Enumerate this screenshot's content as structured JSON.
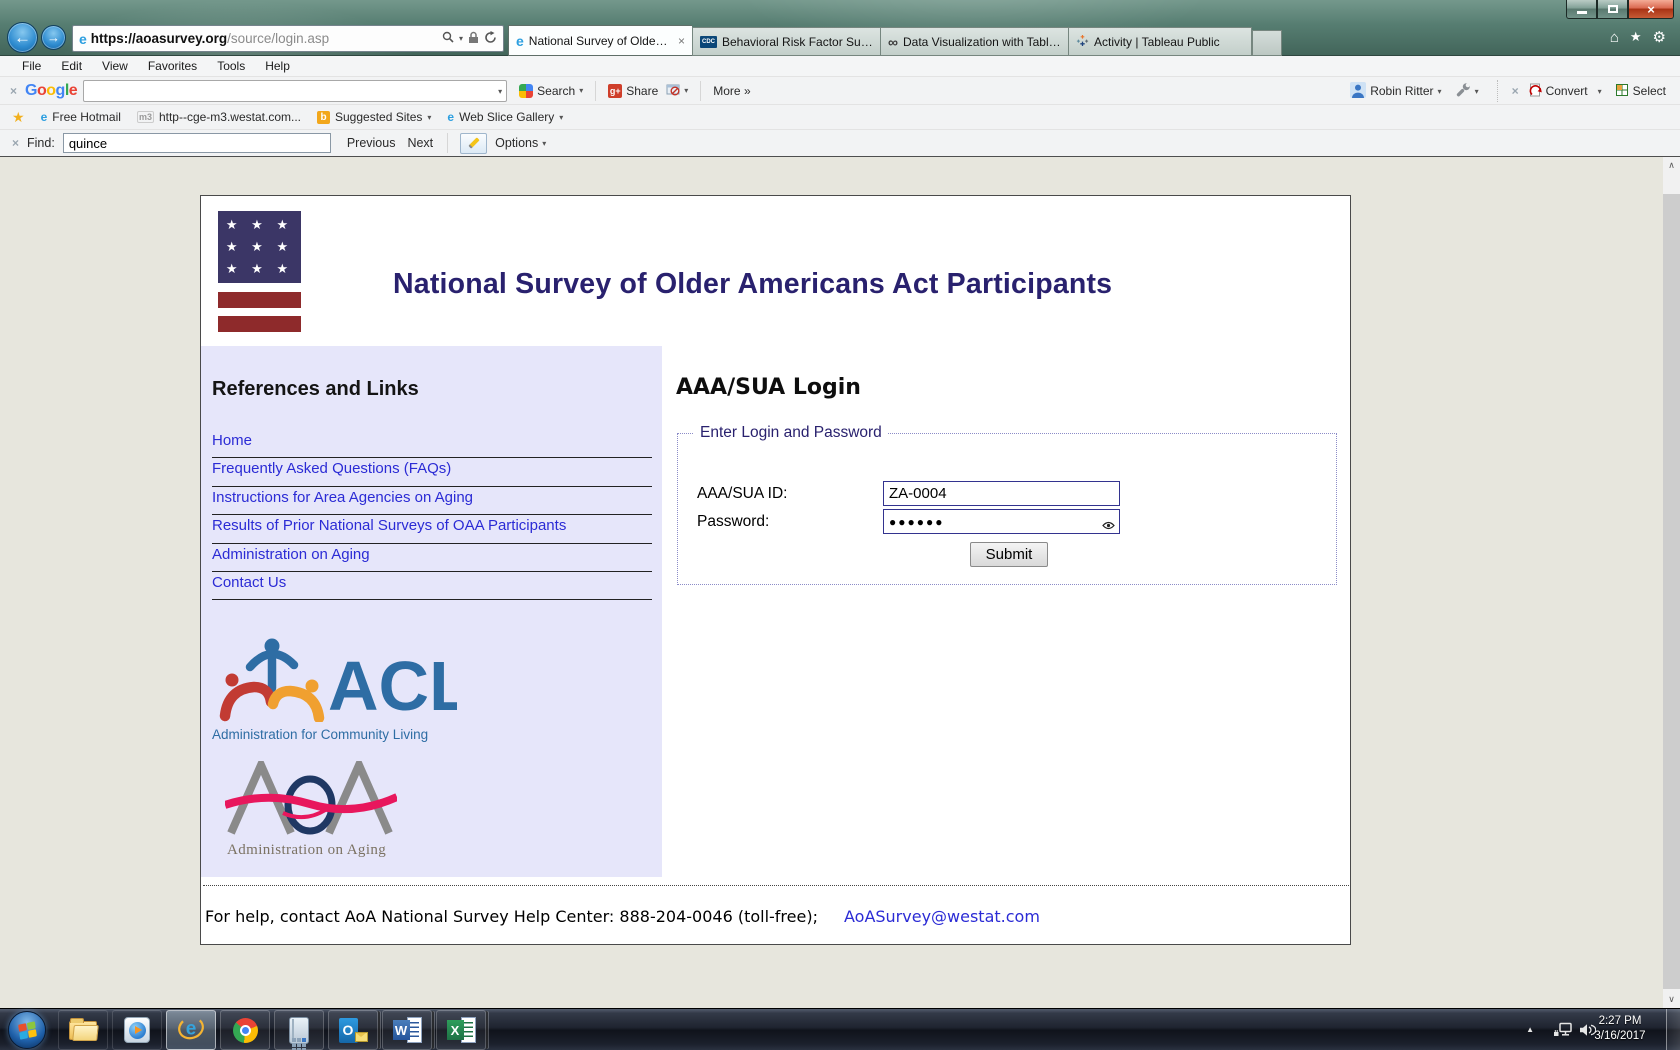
{
  "glyphs": {
    "close": "×",
    "dropdown": "▾",
    "back_arrow": "←",
    "forward_arrow": "→",
    "home": "⌂",
    "star": "★",
    "gear": "⚙",
    "infinity": "∞",
    "e": "e",
    "cdc": "CDC",
    "gplus": "g+",
    "b": "b",
    "m3": "m3",
    "star_row": "★ ★ ★",
    "up_chevron": "∧",
    "down_chevron": "∨",
    "tray_up": "▲",
    "letter_o": "O",
    "letter_w": "W",
    "letter_x": "X"
  },
  "browser": {
    "address": {
      "host": "https://aoasurvey.org",
      "path": "/source/login.asp"
    },
    "tabs": [
      {
        "label": "National Survey of Older A...",
        "icon": "internet-explorer"
      },
      {
        "label": "Behavioral Risk Factor Surveilla...",
        "icon": "cdc"
      },
      {
        "label": "Data Visualization with Tablea...",
        "icon": "tableau-infinity"
      },
      {
        "label": "Activity | Tableau Public",
        "icon": "tableau-public"
      }
    ],
    "menu_items": [
      "File",
      "Edit",
      "View",
      "Favorites",
      "Tools",
      "Help"
    ],
    "google": {
      "letters": [
        "G",
        "o",
        "o",
        "g",
        "l",
        "e"
      ],
      "search_label": "Search",
      "share_label": "Share",
      "more_label": "More »",
      "user_name": "Robin Ritter",
      "convert_label": "Convert",
      "select_label": "Select"
    },
    "favorites": {
      "items": [
        "Free Hotmail",
        "http--cge-m3.westat.com...",
        "Suggested Sites",
        "Web Slice Gallery"
      ]
    },
    "find": {
      "label": "Find:",
      "value": "quince",
      "previous_label": "Previous",
      "next_label": "Next",
      "options_label": "Options"
    }
  },
  "page": {
    "title": "National Survey of Older Americans Act Participants",
    "sidebar": {
      "heading": "References and Links",
      "links": [
        "Home",
        "Frequently Asked Questions (FAQs)",
        "Instructions for Area Agencies on Aging",
        "Results of Prior National Surveys of OAA Participants",
        "Administration on Aging",
        "Contact Us"
      ],
      "acl_text": "ACL",
      "acl_subtitle": "Administration for Community Living",
      "aoa_subtitle": "Administration on Aging"
    },
    "login": {
      "heading": "AAA/SUA Login",
      "legend": "Enter Login and Password",
      "id_label": "AAA/SUA ID:",
      "id_value": "ZA-0004",
      "password_label": "Password:",
      "password_value": "●●●●●●",
      "submit_label": "Submit"
    },
    "footer": {
      "text": "For help, contact AoA National Survey Help Center: 888-204-0046 (toll-free);",
      "email": "AoASurvey@westat.com"
    }
  },
  "taskbar": {
    "apps": [
      "start",
      "windows-explorer",
      "windows-media-player",
      "internet-explorer",
      "google-chrome",
      "calculator",
      "outlook",
      "word",
      "excel"
    ],
    "clock": {
      "time": "2:27 PM",
      "date": "3/16/2017"
    }
  },
  "colors": {
    "link_blue": "#2B2BD5",
    "title_navy": "#29216E",
    "sidebar_lavender": "#E6E6FA",
    "flag_navy": "#3B3666",
    "flag_red": "#8E2A2B",
    "acl_blue": "#2E6DA4",
    "aoa_pink": "#E8175D",
    "glass_teal": "#567D71"
  }
}
